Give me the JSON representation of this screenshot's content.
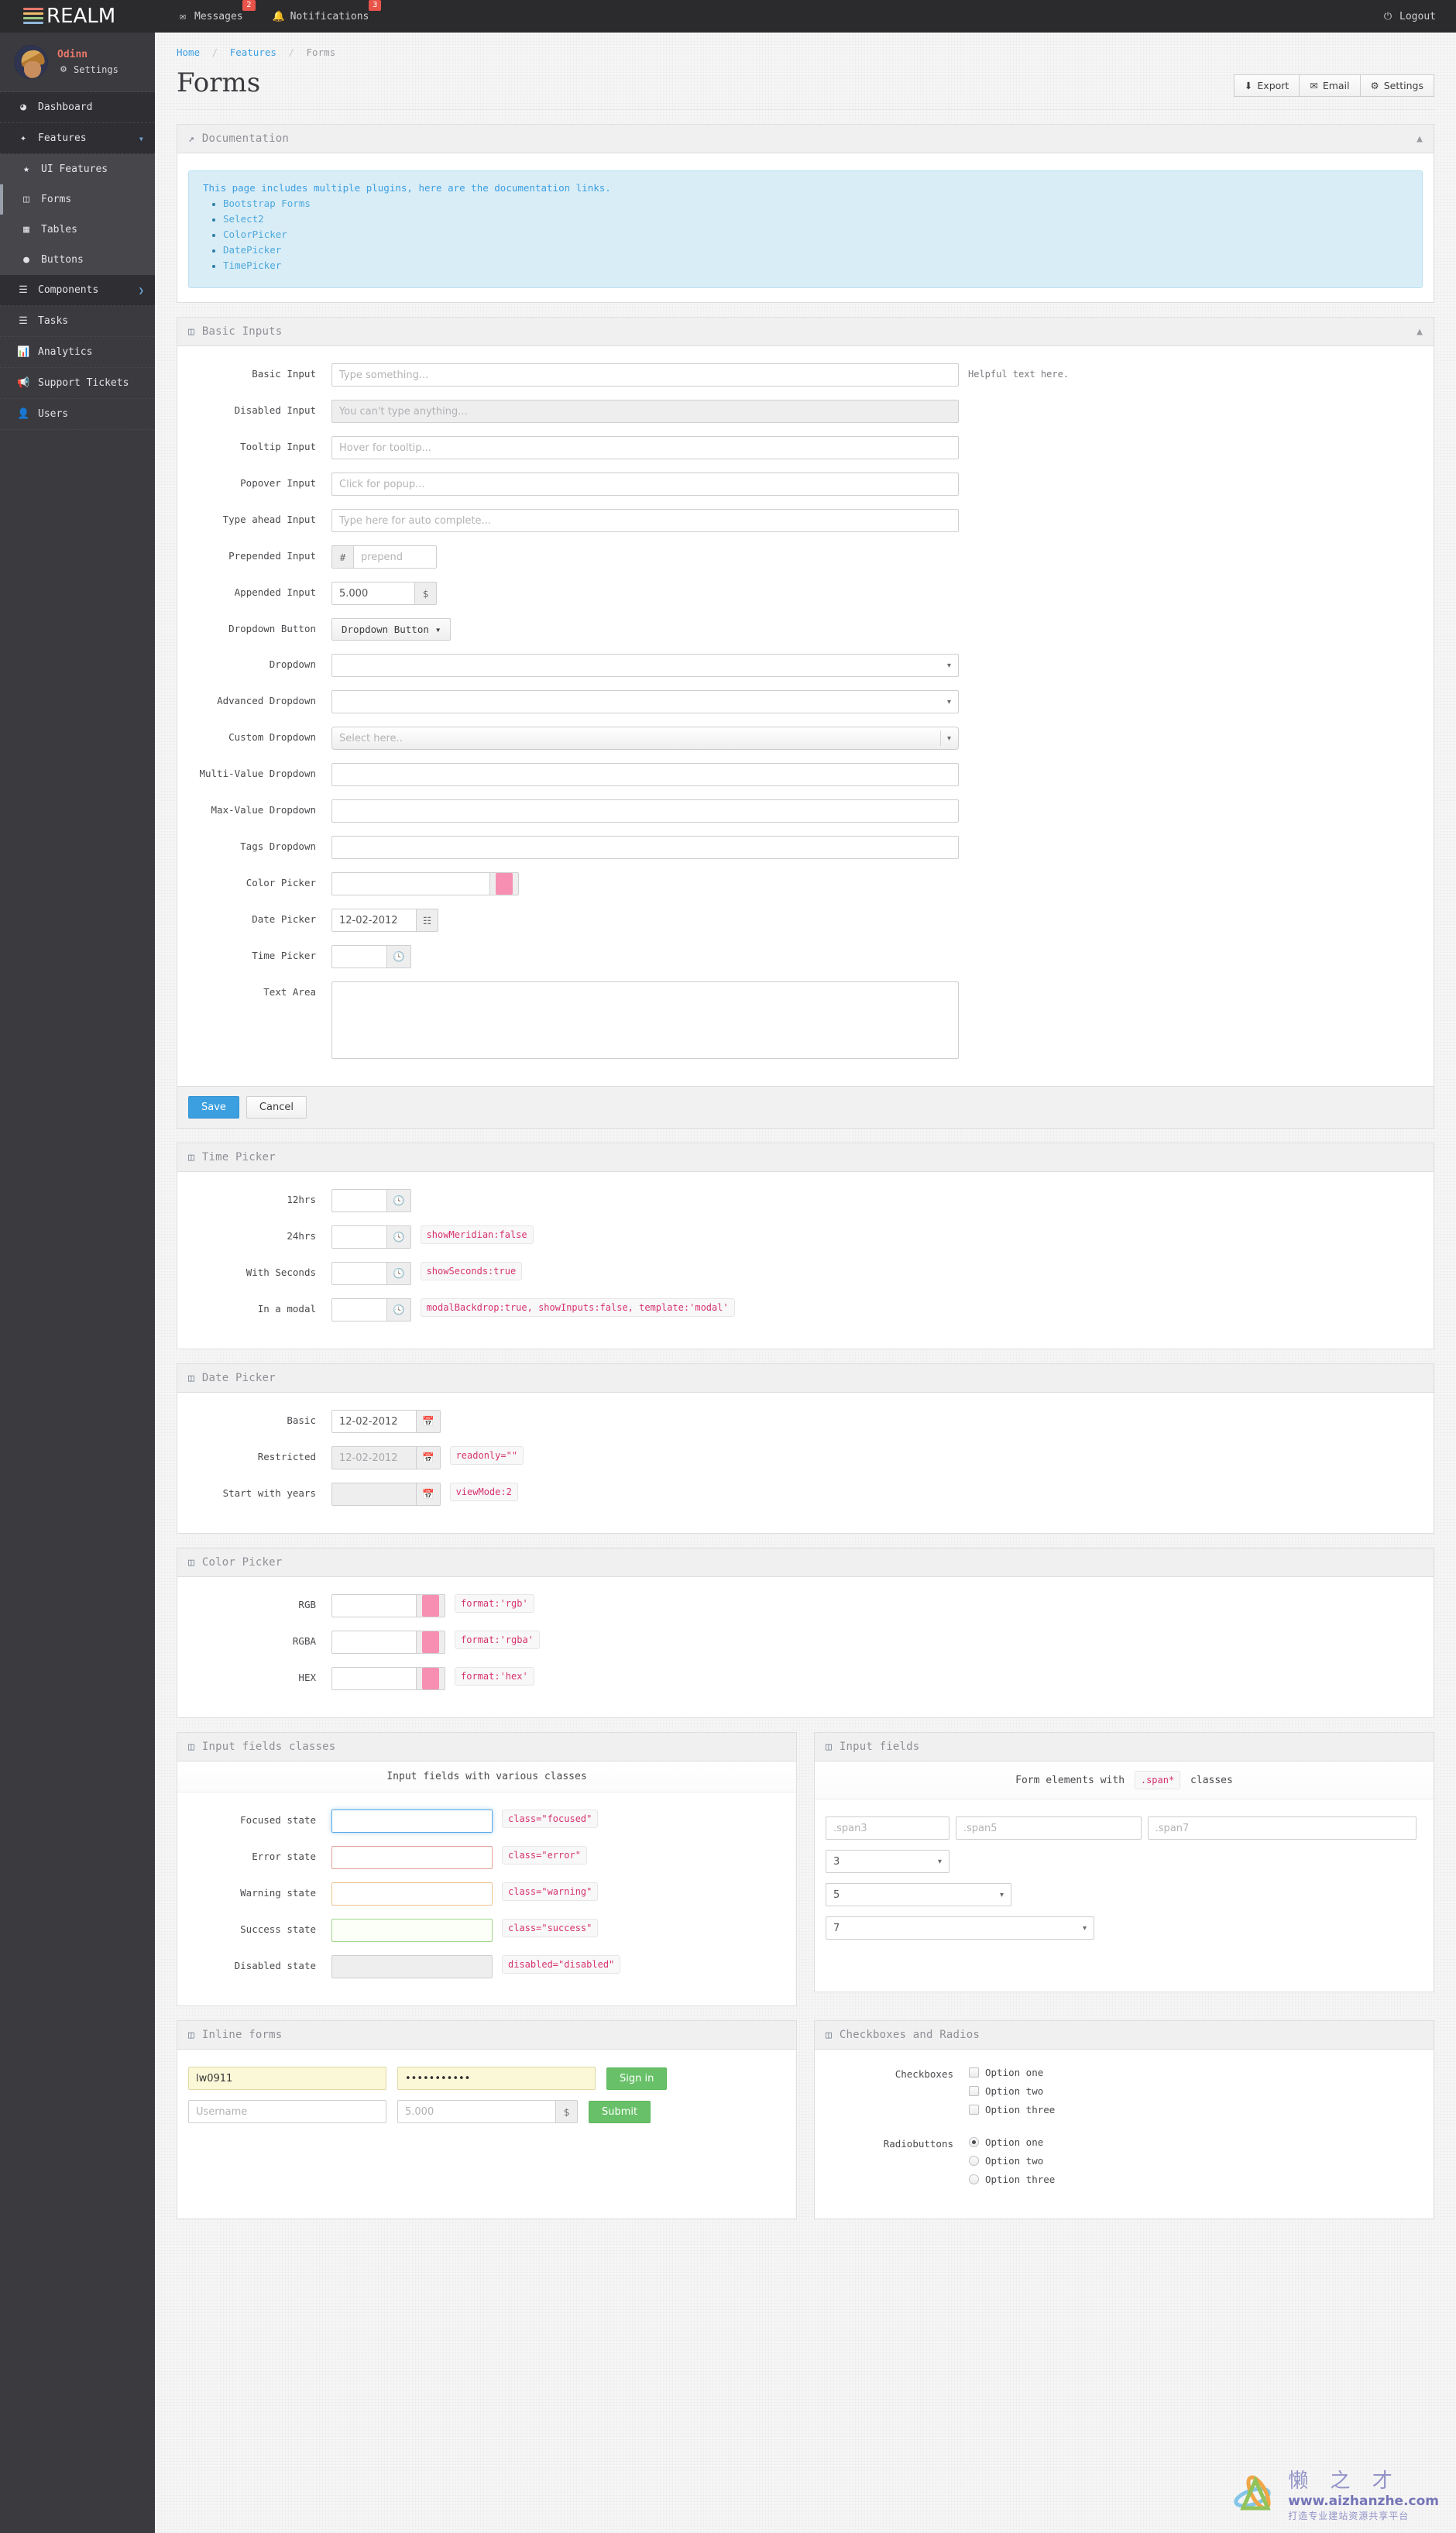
{
  "brand": {
    "name": "REALM"
  },
  "topbar": {
    "messages": {
      "label": "Messages",
      "badge": "2",
      "icon": "envelope-icon"
    },
    "notifications": {
      "label": "Notifications",
      "badge": "3",
      "icon": "bell-icon"
    },
    "logout": {
      "label": "Logout",
      "icon": "power-icon"
    }
  },
  "sidebar": {
    "profile": {
      "name": "Odinn",
      "settings_label": "Settings"
    },
    "items": [
      {
        "label": "Dashboard",
        "icon": "dashboard-icon"
      },
      {
        "label": "Features",
        "icon": "magic-wand-icon",
        "caret": "▾"
      },
      {
        "label": "UI Features",
        "icon": "star-icon"
      },
      {
        "label": "Forms",
        "icon": "form-icon"
      },
      {
        "label": "Tables",
        "icon": "table-icon"
      },
      {
        "label": "Buttons",
        "icon": "circle-icon"
      },
      {
        "label": "Components",
        "icon": "bars-icon",
        "caret": "❯"
      },
      {
        "label": "Tasks",
        "icon": "tasks-icon"
      },
      {
        "label": "Analytics",
        "icon": "chart-icon"
      },
      {
        "label": "Support Tickets",
        "icon": "megaphone-icon"
      },
      {
        "label": "Users",
        "icon": "user-icon"
      }
    ]
  },
  "breadcrumb": {
    "home": "Home",
    "features": "Features",
    "current": "Forms"
  },
  "page": {
    "title": "Forms"
  },
  "head_actions": [
    {
      "label": "Export",
      "icon": "download-icon"
    },
    {
      "label": "Email",
      "icon": "envelope-icon"
    },
    {
      "label": "Settings",
      "icon": "gear-icon"
    }
  ],
  "documentation": {
    "title": "Documentation",
    "lead": "This page includes multiple plugins, here are the documentation links.",
    "links": [
      "Bootstrap Forms",
      "Select2",
      "ColorPicker",
      "DatePicker",
      "TimePicker"
    ]
  },
  "basic_inputs": {
    "title": "Basic Inputs",
    "labels": {
      "basic": "Basic Input",
      "disabled": "Disabled Input",
      "tooltip": "Tooltip Input",
      "popover": "Popover Input",
      "typeahead": "Type ahead Input",
      "prepended": "Prepended Input",
      "appended": "Appended Input",
      "dropdown_button": "Dropdown Button",
      "dropdown": "Dropdown",
      "advanced_dropdown": "Advanced Dropdown",
      "custom_dropdown": "Custom Dropdown",
      "multi_value_dropdown": "Multi-Value Dropdown",
      "max_value_dropdown": "Max-Value Dropdown",
      "tags_dropdown": "Tags Dropdown",
      "color_picker": "Color Picker",
      "date_picker": "Date Picker",
      "time_picker": "Time Picker",
      "text_area": "Text Area"
    },
    "placeholders": {
      "basic": "Type something...",
      "disabled": "You can't type anything...",
      "tooltip": "Hover for tooltip...",
      "popover": "Click for popup...",
      "typeahead": "Type here for auto complete...",
      "prepended": "prepend",
      "custom_dropdown": "Select here.."
    },
    "values": {
      "appended": "5.000",
      "date_picker": "12-02-2012"
    },
    "addons": {
      "prepend": "#",
      "append": "$"
    },
    "dropdown_button_label": "Dropdown Button",
    "help_text": "Helpful text here.",
    "color_swatch": "#f78fb3",
    "footer": {
      "save": "Save",
      "cancel": "Cancel"
    }
  },
  "time_picker": {
    "title": "Time Picker",
    "rows": [
      {
        "label": "12hrs",
        "code": ""
      },
      {
        "label": "24hrs",
        "code": "showMeridian:false"
      },
      {
        "label": "With Seconds",
        "code": "showSeconds:true"
      },
      {
        "label": "In a modal",
        "code": "modalBackdrop:true, showInputs:false, template:'modal'"
      }
    ]
  },
  "date_picker": {
    "title": "Date Picker",
    "rows": [
      {
        "label": "Basic",
        "value": "12-02-2012",
        "code": "",
        "disabled": false
      },
      {
        "label": "Restricted",
        "value": "12-02-2012",
        "code": "readonly=\"\"",
        "disabled": true
      },
      {
        "label": "Start with years",
        "value": "",
        "code": "viewMode:2",
        "disabled": true
      }
    ]
  },
  "color_picker": {
    "title": "Color Picker",
    "rows": [
      {
        "label": "RGB",
        "code": "format:'rgb'"
      },
      {
        "label": "RGBA",
        "code": "format:'rgba'"
      },
      {
        "label": "HEX",
        "code": "format:'hex'"
      }
    ],
    "swatch": "#f78fb3"
  },
  "input_classes": {
    "title": "Input fields classes",
    "subtitle": "Input fields with various classes",
    "rows": [
      {
        "label": "Focused state",
        "code": "class=\"focused\"",
        "state": "focused"
      },
      {
        "label": "Error state",
        "code": "class=\"error\"",
        "state": "error"
      },
      {
        "label": "Warning state",
        "code": "class=\"warning\"",
        "state": "warning"
      },
      {
        "label": "Success state",
        "code": "class=\"success\"",
        "state": "success"
      },
      {
        "label": "Disabled state",
        "code": "disabled=\"disabled\"",
        "state": "disabled"
      }
    ]
  },
  "input_fields": {
    "title": "Input fields",
    "subtitle_pre": "Form elements with",
    "subtitle_code": ".span*",
    "subtitle_post": "classes",
    "inputs": [
      {
        "placeholder": ".span3",
        "size": "span3"
      },
      {
        "placeholder": ".span5",
        "size": "span5"
      },
      {
        "placeholder": ".span7",
        "size": "span7"
      }
    ],
    "selects": [
      {
        "value": "3",
        "size": "span3"
      },
      {
        "value": "5",
        "size": "span5"
      },
      {
        "value": "7",
        "size": "span7"
      }
    ]
  },
  "inline_forms": {
    "title": "Inline forms",
    "row1": {
      "username_value": "lw0911",
      "password_value": "•••••••••••",
      "button": "Sign in"
    },
    "row2": {
      "username_placeholder": "Username",
      "amount_placeholder": "5.000",
      "addon": "$",
      "button": "Submit"
    }
  },
  "checkboxes_radios": {
    "title": "Checkboxes and Radios",
    "checkbox_label": "Checkboxes",
    "checkboxes": [
      "Option one",
      "Option two",
      "Option three"
    ],
    "radio_label": "Radiobuttons",
    "radios": [
      "Option one",
      "Option two",
      "Option three"
    ],
    "radio_selected": 0
  },
  "watermark": {
    "cn": "懒 之 才",
    "url": "www.aizhanzhe.com",
    "sub": "打造专业建站资源共享平台"
  }
}
